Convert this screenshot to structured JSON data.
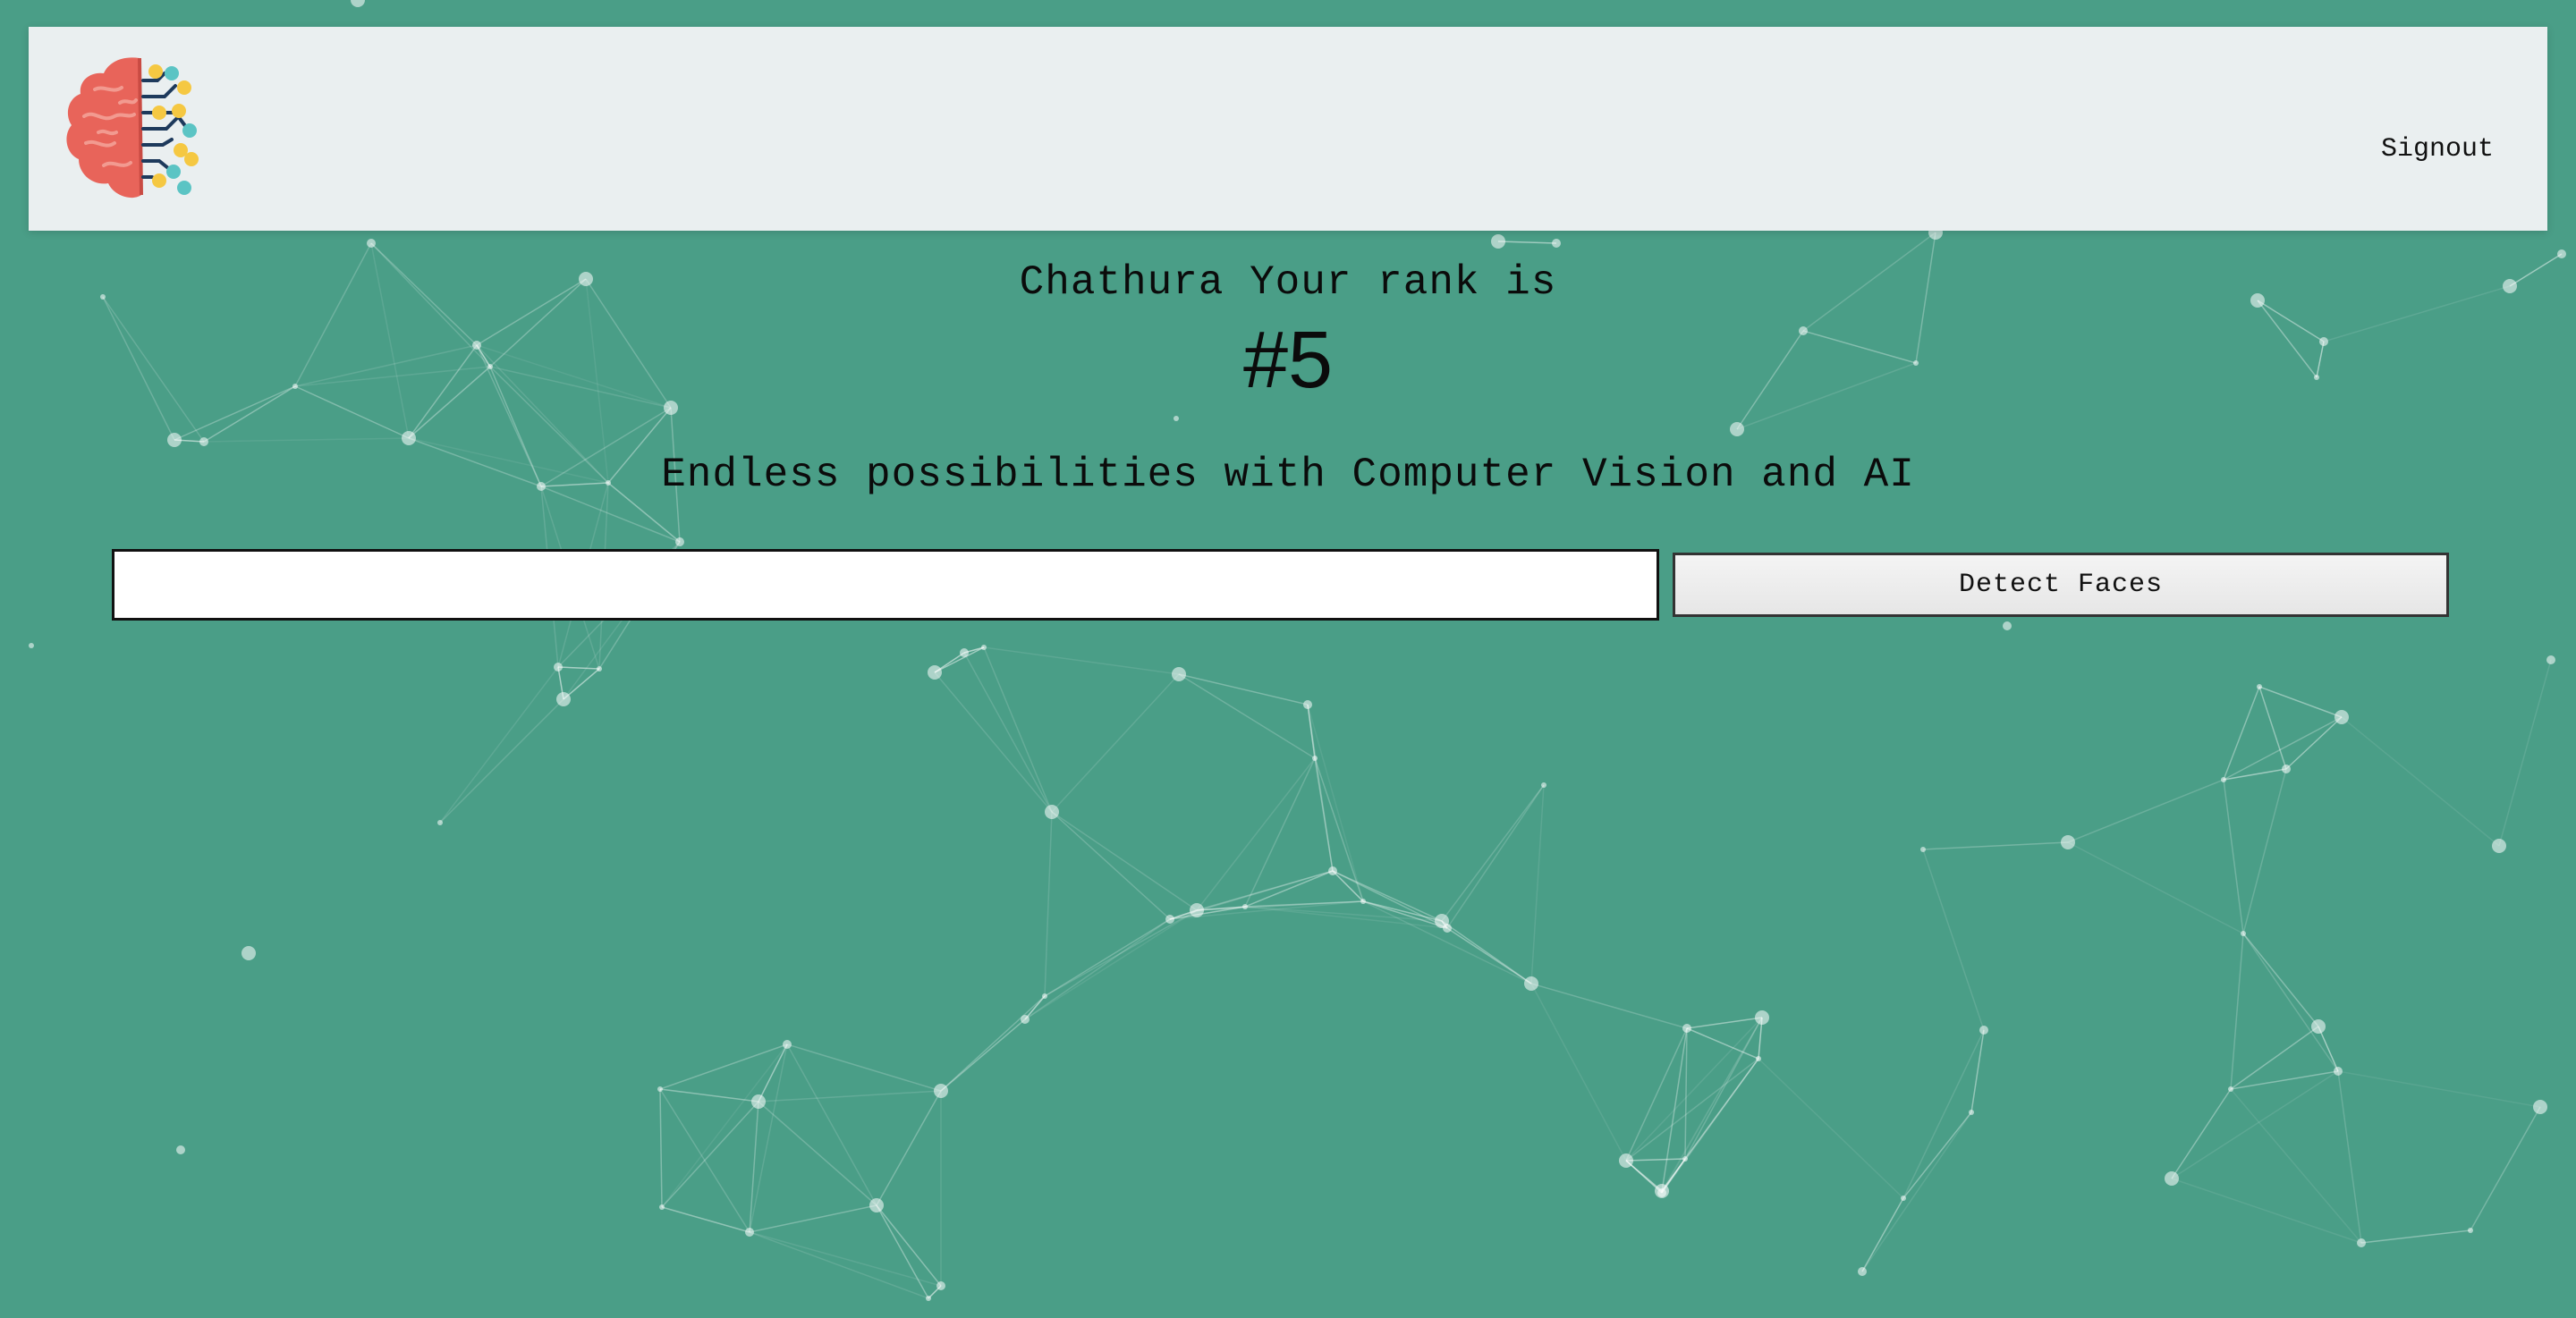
{
  "nav": {
    "signout_label": "Signout",
    "logo_icon": "brain-circuit-logo-icon"
  },
  "rank": {
    "line": "Chathura Your rank is",
    "value": "#5"
  },
  "tagline": "Endless possibilities with Computer Vision and AI",
  "image_url_input": {
    "value": "",
    "placeholder": ""
  },
  "detect_button_label": "Detect Faces",
  "colors": {
    "background": "#4a9e87",
    "nav_background": "#eaeff0",
    "particle_color": "#ffffff",
    "brain_color": "#e8645a",
    "circuit_dot_yellow": "#f5c842",
    "circuit_dot_teal": "#5bc4c4",
    "circuit_line": "#1e3a5c"
  }
}
